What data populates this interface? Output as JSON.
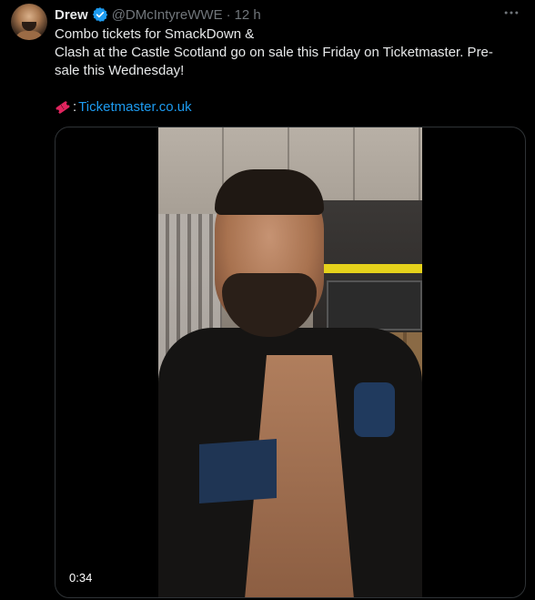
{
  "author": {
    "name": "Drew",
    "handle": "@DMcIntyreWWE",
    "separator": "·",
    "time": "12 h"
  },
  "tweet": {
    "line1": "Combo tickets for SmackDown &",
    "line2": "Clash at the Castle Scotland go on sale this Friday on Ticketmaster. Pre-",
    "line3": "sale this Wednesday!",
    "link_prefix": ":",
    "link_text": "Ticketmaster.co.uk"
  },
  "media": {
    "duration": "0:34"
  },
  "colors": {
    "background": "#000000",
    "text": "#e7e9ea",
    "secondary": "#71767b",
    "link": "#1d9bf0",
    "verified": "#1d9bf0"
  },
  "icons": {
    "verified": "verified-badge-icon",
    "ticket": "ticket-icon",
    "more": "more-options-icon"
  }
}
